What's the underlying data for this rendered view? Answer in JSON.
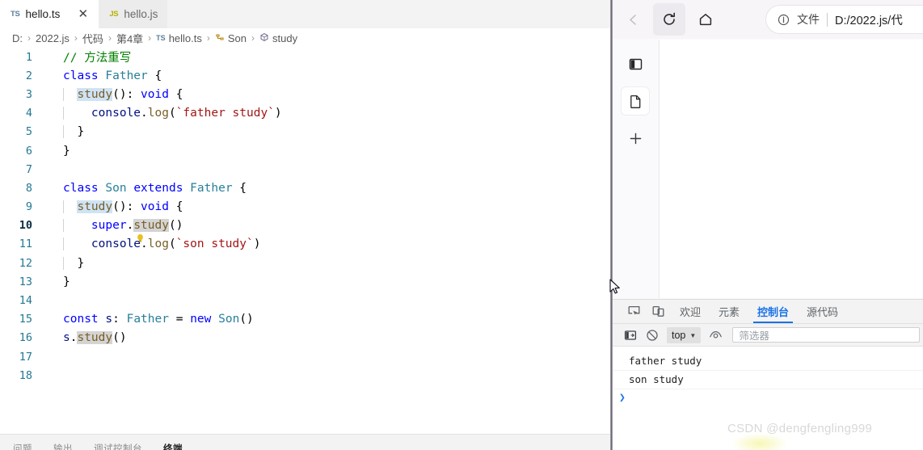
{
  "editor": {
    "tabs": [
      {
        "label": "hello.ts",
        "icon": "typescript-file-icon",
        "badge": "TS",
        "active": true,
        "closable": true
      },
      {
        "label": "hello.js",
        "icon": "javascript-file-icon",
        "badge": "JS",
        "active": false,
        "closable": false
      }
    ],
    "close_glyph": "✕",
    "breadcrumb": [
      {
        "label": "D:",
        "kind": "drive"
      },
      {
        "label": "2022.js",
        "kind": "folder"
      },
      {
        "label": "代码",
        "kind": "folder"
      },
      {
        "label": "第4章",
        "kind": "folder"
      },
      {
        "label": "hello.ts",
        "kind": "file",
        "badge": "TS"
      },
      {
        "label": "Son",
        "kind": "class"
      },
      {
        "label": "study",
        "kind": "method"
      }
    ],
    "breadcrumb_separator": "›",
    "lines": [
      {
        "n": "1",
        "text": "// 方法重写"
      },
      {
        "n": "2",
        "text": "class Father {"
      },
      {
        "n": "3",
        "text": "  study(): void {"
      },
      {
        "n": "4",
        "text": "    console.log(`father study`)"
      },
      {
        "n": "5",
        "text": "  }"
      },
      {
        "n": "6",
        "text": "}"
      },
      {
        "n": "7",
        "text": ""
      },
      {
        "n": "8",
        "text": "class Son extends Father {"
      },
      {
        "n": "9",
        "text": "  study(): void {"
      },
      {
        "n": "10",
        "text": "    super.study()"
      },
      {
        "n": "11",
        "text": "    console.log(`son study`)"
      },
      {
        "n": "12",
        "text": "  }"
      },
      {
        "n": "13",
        "text": "}"
      },
      {
        "n": "14",
        "text": ""
      },
      {
        "n": "15",
        "text": "const s: Father = new Son()"
      },
      {
        "n": "16",
        "text": "s.study()"
      },
      {
        "n": "17",
        "text": ""
      },
      {
        "n": "18",
        "text": ""
      }
    ],
    "current_line": "10",
    "lightbulb_line": "10",
    "lightbulb_icon": "lightbulb-icon",
    "panel_tabs": [
      {
        "label": "问题",
        "active": false
      },
      {
        "label": "输出",
        "active": false
      },
      {
        "label": "调试控制台",
        "active": false
      },
      {
        "label": "终端",
        "active": true
      }
    ]
  },
  "browser": {
    "nav": [
      {
        "name": "back-button",
        "icon": "arrow-left-icon",
        "glyph": "←",
        "disabled": true
      },
      {
        "name": "reload-button",
        "icon": "reload-icon",
        "glyph": "⟳",
        "disabled": false
      },
      {
        "name": "home-button",
        "icon": "home-icon",
        "glyph": "⌂",
        "disabled": false
      }
    ],
    "omnibox": {
      "info_icon": "info-circle-icon",
      "scheme_label": "文件",
      "url": "D:/2022.js/代"
    },
    "rail": [
      {
        "name": "split-screen-button",
        "icon": "panel-layout-icon",
        "selected": false
      },
      {
        "name": "page-button",
        "icon": "document-page-icon",
        "selected": true
      },
      {
        "name": "new-tab-button",
        "icon": "plus-icon",
        "selected": false
      }
    ]
  },
  "devtools": {
    "tool_icons": [
      {
        "name": "inspect-element-button",
        "icon": "inspect-cursor-icon"
      },
      {
        "name": "device-toolbar-button",
        "icon": "device-toggle-icon"
      }
    ],
    "tabs": [
      {
        "label": "欢迎",
        "active": false
      },
      {
        "label": "元素",
        "active": false
      },
      {
        "label": "控制台",
        "active": true
      },
      {
        "label": "源代码",
        "active": false
      }
    ],
    "console_toolbar": {
      "sidebar_icon": "console-sidebar-icon",
      "clear_icon": "clear-console-icon",
      "context_value": "top",
      "context_caret": "▼",
      "eye_icon": "live-expression-eye-icon",
      "filter_placeholder": "筛选器"
    },
    "log": [
      {
        "text": "father study"
      },
      {
        "text": "son study"
      }
    ],
    "prompt_glyph": "❯"
  },
  "watermark": {
    "text": "CSDN @dengfengling999"
  },
  "colors": {
    "accent_blue": "#1a73e8",
    "ts_badge": "#5a7d9a",
    "js_badge": "#b3b300",
    "line_number": "#237893",
    "divider": "#9b96a3"
  }
}
